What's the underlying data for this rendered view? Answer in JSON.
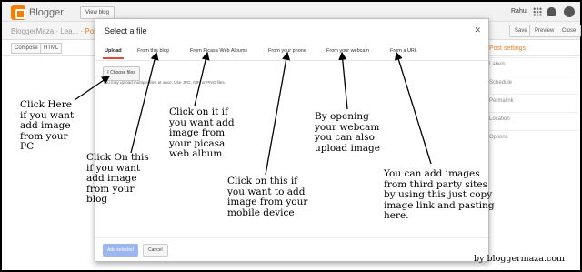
{
  "topbar": {
    "brand": "Blogger",
    "view_blog": "View blog",
    "user": "Rahul",
    "icons": [
      "apps-icon",
      "notifications-icon",
      "avatar"
    ]
  },
  "postbar": {
    "blog_name": "BloggerMaza · Lea...",
    "post_label": "· Pos",
    "save": "Save",
    "preview": "Preview",
    "close": "Close"
  },
  "editor": {
    "compose": "Compose",
    "html": "HTML"
  },
  "sidebar": {
    "heading": "Post settings",
    "items": [
      "Labels",
      "Schedule",
      "Permalink",
      "Location",
      "Options"
    ]
  },
  "dialog": {
    "title": "Select a file",
    "close_icon": "close-icon",
    "tabs": [
      "Upload",
      "From this blog",
      "From Picasa Web Albums",
      "From your phone",
      "From your webcam",
      "From a URL"
    ],
    "active_tab": "Upload",
    "choose_files": "Choose files",
    "hint": "You may upload multiple files at once. Use JPG, GIF, or PNG files.",
    "add_selected": "Add selected",
    "cancel": "Cancel"
  },
  "annotations": {
    "upload": "Click Here\nif you want\nadd image\nfrom your\nPC",
    "this_blog": "Click On this\nif you want\nadd image\nfrom your\nblog",
    "picasa": "Click on it if\nyou want add\nimage from\nyour picasa\nweb album",
    "phone": "Click on this if\nyou want to add\nimage from your\nmobile device",
    "webcam": "By opening\nyour webcam\nyou can also\nupload image",
    "url": "You can add  images\nfrom third party sites\nby using this just copy\nimage link and pasting\nhere.",
    "byline": "by bloggermaza.com"
  }
}
